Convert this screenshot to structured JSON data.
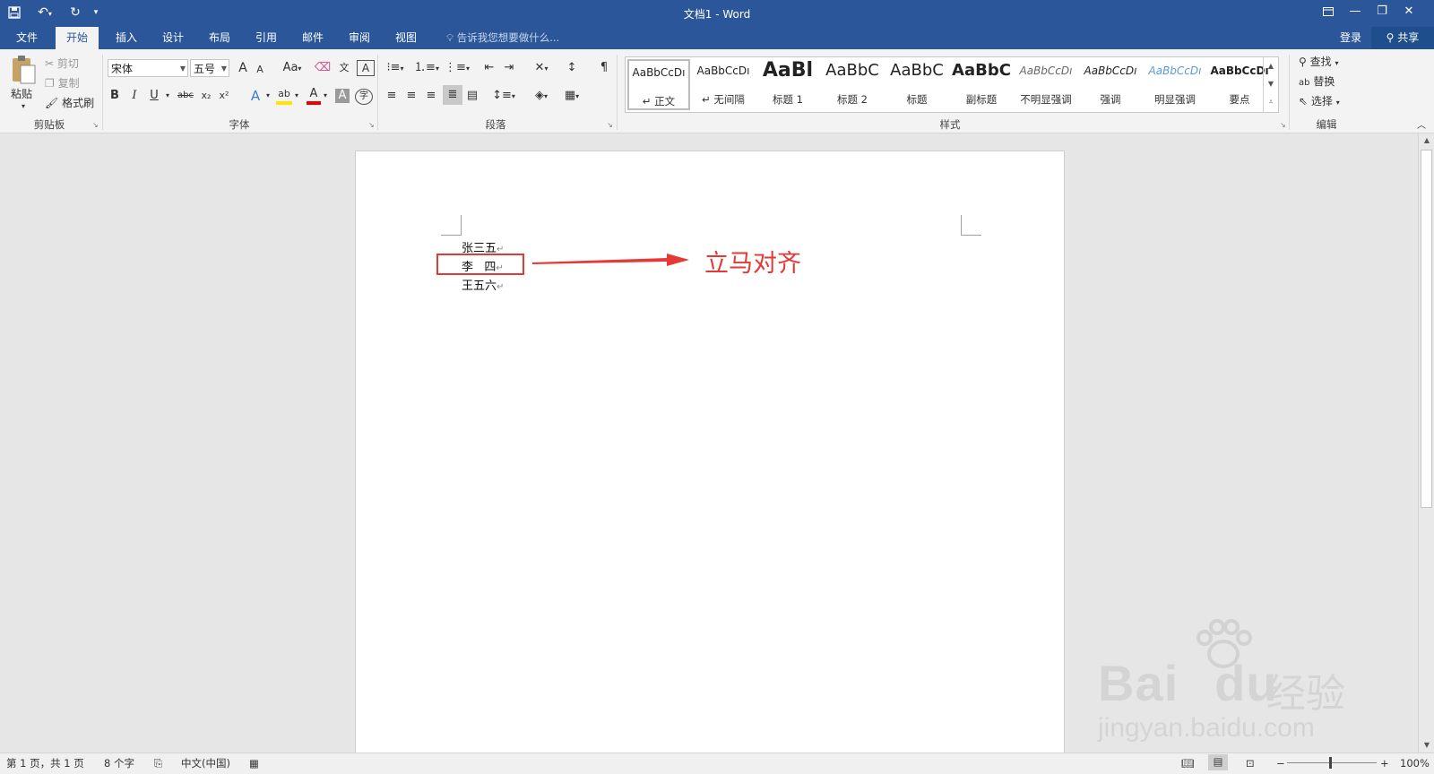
{
  "window": {
    "title": "文档1 - Word",
    "controls": {
      "ribbon_options": "ribbon-display-options-icon",
      "minimize": "minimize-icon",
      "restore": "restore-icon",
      "close": "close-icon"
    }
  },
  "quick_access": {
    "save": "save-icon",
    "undo": "undo-icon",
    "repeat": "repeat-icon",
    "customize": "customize-qat-icon"
  },
  "tabs": [
    {
      "label": "文件"
    },
    {
      "label": "开始"
    },
    {
      "label": "插入"
    },
    {
      "label": "设计"
    },
    {
      "label": "布局"
    },
    {
      "label": "引用"
    },
    {
      "label": "邮件"
    },
    {
      "label": "审阅"
    },
    {
      "label": "视图"
    }
  ],
  "tell_me": {
    "placeholder": "告诉我您想要做什么..."
  },
  "account": {
    "login": "登录",
    "share": "共享"
  },
  "clipboard": {
    "label": "剪贴板",
    "paste": "粘贴",
    "cut": "剪切",
    "copy": "复制",
    "format_painter": "格式刷"
  },
  "font": {
    "label": "字体",
    "family": "宋体",
    "size": "五号",
    "buttons": {
      "bold": "B",
      "italic": "I",
      "underline": "U",
      "strike": "abc",
      "sub": "x₂",
      "sup": "x²",
      "grow": "A",
      "shrink": "A",
      "case": "Aa",
      "clear": "clear-formatting-icon",
      "phonetic": "文",
      "border": "A",
      "effects": "A",
      "highlight": "ab",
      "color": "A",
      "shade": "A",
      "enclose": "字"
    }
  },
  "paragraph": {
    "label": "段落"
  },
  "styles": {
    "label": "样式",
    "items": [
      {
        "sample": "AaBbCcDı",
        "name": "↵ 正文"
      },
      {
        "sample": "AaBbCcDı",
        "name": "↵ 无间隔"
      },
      {
        "sample": "AaBl",
        "name": "标题 1"
      },
      {
        "sample": "AaBbC",
        "name": "标题 2"
      },
      {
        "sample": "AaBbC",
        "name": "标题"
      },
      {
        "sample": "AaBbC",
        "name": "副标题"
      },
      {
        "sample": "AaBbCcDı",
        "name": "不明显强调"
      },
      {
        "sample": "AaBbCcDı",
        "name": "强调"
      },
      {
        "sample": "AaBbCcDı",
        "name": "明显强调"
      },
      {
        "sample": "AaBbCcDı",
        "name": "要点"
      }
    ]
  },
  "editing": {
    "label": "编辑",
    "find": "查找",
    "replace": "替换",
    "select": "选择"
  },
  "document": {
    "lines": [
      {
        "text": "张三五",
        "mark": "↵"
      },
      {
        "text": "李   四",
        "mark": "↵"
      },
      {
        "text": "王五六",
        "mark": "↵"
      }
    ],
    "annotation": "立马对齐"
  },
  "status": {
    "page": "第 1 页，共 1 页",
    "words": "8 个字",
    "language": "中文(中国)",
    "zoom": "100%"
  },
  "watermark": {
    "brand": "Bai",
    "brand2": "du",
    "cn": "经验",
    "url": "jingyan.baidu.com"
  }
}
